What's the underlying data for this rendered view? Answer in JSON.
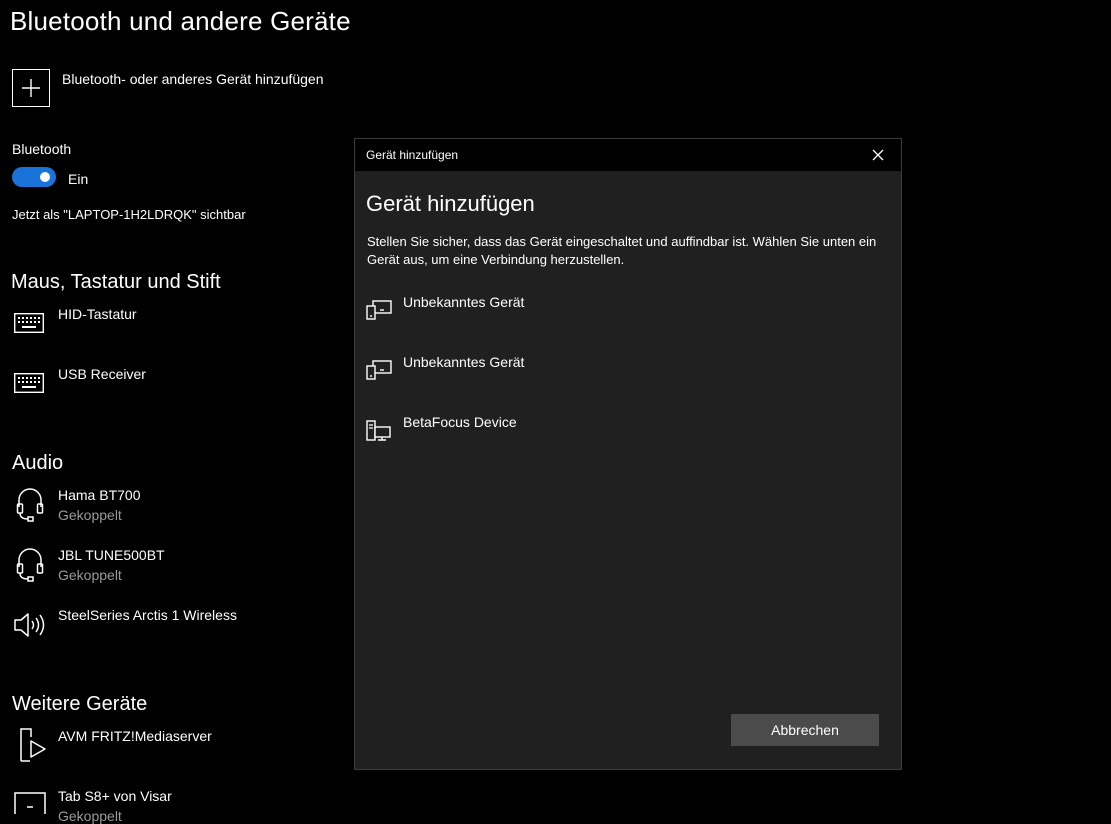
{
  "page": {
    "title": "Bluetooth und andere Geräte",
    "add_device_label": "Bluetooth- oder anderes Gerät hinzufügen",
    "bluetooth_label": "Bluetooth",
    "toggle_state": "Ein",
    "toggle_on": true,
    "visibility_text": "Jetzt als \"LAPTOP-1H2LDRQK\" sichtbar"
  },
  "sections": {
    "input": {
      "title": "Maus, Tastatur und Stift",
      "devices": [
        {
          "name": "HID-Tastatur",
          "icon": "keyboard-icon"
        },
        {
          "name": "USB Receiver",
          "icon": "keyboard-icon"
        }
      ]
    },
    "audio": {
      "title": "Audio",
      "devices": [
        {
          "name": "Hama BT700",
          "status": "Gekoppelt",
          "icon": "headset-icon"
        },
        {
          "name": "JBL TUNE500BT",
          "status": "Gekoppelt",
          "icon": "headset-icon"
        },
        {
          "name": "SteelSeries Arctis 1 Wireless",
          "icon": "speaker-icon"
        }
      ]
    },
    "other": {
      "title": "Weitere Geräte",
      "devices": [
        {
          "name": "AVM FRITZ!Mediaserver",
          "icon": "media-device-icon"
        },
        {
          "name": "Tab S8+ von Visar",
          "status": "Gekoppelt",
          "icon": "tablet-icon"
        }
      ]
    }
  },
  "dialog": {
    "window_title": "Gerät hinzufügen",
    "heading": "Gerät hinzufügen",
    "description": "Stellen Sie sicher, dass das Gerät eingeschaltet und auffindbar ist. Wählen Sie unten ein Gerät aus, um eine Verbindung herzustellen.",
    "devices": [
      {
        "name": "Unbekanntes Gerät",
        "icon": "devices-icon"
      },
      {
        "name": "Unbekanntes Gerät",
        "icon": "devices-icon"
      },
      {
        "name": "BetaFocus Device",
        "icon": "computer-devices-icon"
      }
    ],
    "cancel_label": "Abbrechen"
  },
  "colors": {
    "accent": "#1a73d9",
    "dialog_bg": "#202020",
    "button_bg": "#4b4b4b",
    "secondary_text": "#9a9a9a"
  }
}
